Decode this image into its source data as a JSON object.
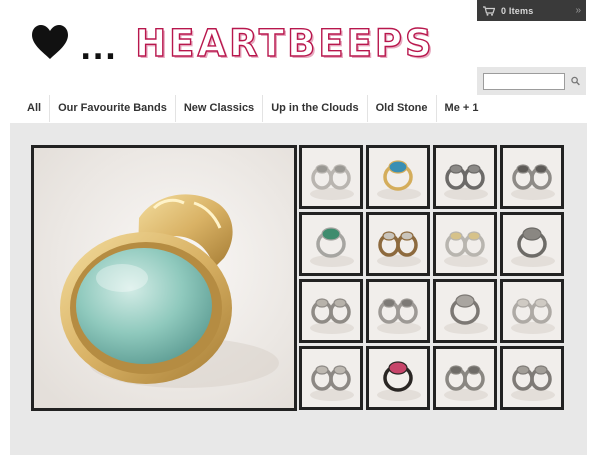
{
  "cart": {
    "count_label": "0 Items",
    "icon": "cart-icon",
    "arrow_glyph": "»"
  },
  "logo": {
    "symbol": "♥",
    "dots": "...",
    "brand": "HEARTBEEPS"
  },
  "search": {
    "placeholder": "",
    "value": "",
    "icon": "search-icon"
  },
  "nav": {
    "items": [
      {
        "label": "All"
      },
      {
        "label": "Our Favourite Bands"
      },
      {
        "label": "New Classics"
      },
      {
        "label": "Up in the Clouds"
      },
      {
        "label": "Old Stone"
      },
      {
        "label": "Me + 1"
      }
    ]
  },
  "gallery": {
    "main": {
      "stone_color": "#8fc9bd",
      "metal_color": "#d9b265"
    },
    "thumbnails": [
      {
        "metal": "#b9b5b0",
        "stone": "#9a9893"
      },
      {
        "metal": "#d4ad5b",
        "stone": "#3a8fb3"
      },
      {
        "metal": "#6c6a68",
        "stone": "#8b8986"
      },
      {
        "metal": "#8e8b87",
        "stone": "#5e5b58"
      },
      {
        "metal": "#a6a5a1",
        "stone": "#3f8c6e"
      },
      {
        "metal": "#8d6a3e",
        "stone": "#c9c4bb"
      },
      {
        "metal": "#b8b5af",
        "stone": "#d6c28a"
      },
      {
        "metal": "#6d6b67",
        "stone": "#8a8782"
      },
      {
        "metal": "#8f8b86",
        "stone": "#b7b2aa"
      },
      {
        "metal": "#9d9995",
        "stone": "#7d7a76"
      },
      {
        "metal": "#7c7874",
        "stone": "#a9a5a0"
      },
      {
        "metal": "#aeaaa5",
        "stone": "#cfcac3"
      },
      {
        "metal": "#8c8884",
        "stone": "#bdb8b1"
      },
      {
        "metal": "#2a2624",
        "stone": "#c7456a"
      },
      {
        "metal": "#8a8782",
        "stone": "#6f6c68"
      },
      {
        "metal": "#7f7b77",
        "stone": "#a29e98"
      }
    ]
  }
}
